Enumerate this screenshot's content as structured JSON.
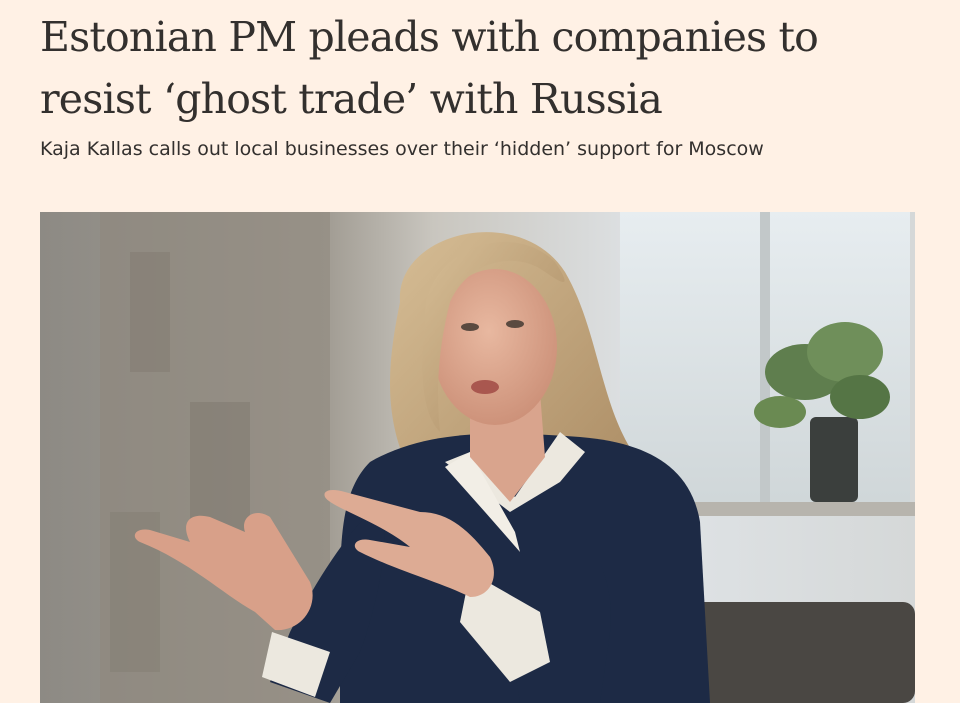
{
  "article": {
    "headline": "Estonian PM pleads with companies to resist ‘ghost trade’ with Russia",
    "standfirst": "Kaja Kallas calls out local businesses over their ‘hidden’ support for Moscow"
  },
  "photo": {
    "subject": "woman-gesturing"
  },
  "colors": {
    "background": "#fff1e5",
    "text": "#33302e"
  }
}
